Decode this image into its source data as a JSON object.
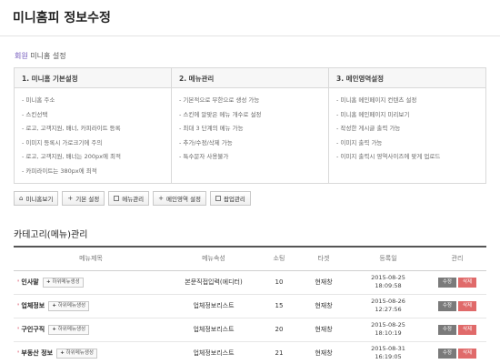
{
  "page": {
    "title": "미니홈피 정보수정"
  },
  "breadcrumb": {
    "highlight": "회원",
    "rest": " 미니홈 설정"
  },
  "info_columns": [
    {
      "title": "1. 미니홈 기본설정",
      "items": [
        "- 미니홈 주소",
        "- 스킨선택",
        "- 로고, 고객지원, 배너, 카피라이트 등록",
        "- 이미지 등록시 가로크기에 주의",
        "- 로고, 고객지원, 배너는 200px에 최적",
        "- 카피라이트는 380px에 최적"
      ]
    },
    {
      "title": "2. 메뉴관리",
      "items": [
        "- 기본적으로 무한으로 생성 가능",
        "- 스킨에 알맞은 메뉴 개수로 설정",
        "- 최대 3 단계의 메뉴 가능",
        "- 추가/수정/삭제 가능",
        "- 특수문자 사용불가"
      ]
    },
    {
      "title": "3. 메인영역설정",
      "items": [
        "- 미니홈 메인페이지 컨텐츠 설정",
        "- 미니홈 메인페이지 미리보기",
        "- 작성한 게시글 출력 가능",
        "- 이미지 출력 가능",
        "- 이미지 출력시 영역사이즈에 맞게 업로드"
      ]
    }
  ],
  "toolbar": {
    "home_preview": "미니홈보기",
    "basic_settings": "기본 설정",
    "menu_manage": "메뉴관리",
    "main_area": "메인영역 설정",
    "popup_manage": "팝업관리"
  },
  "section": {
    "title": "카테고리(메뉴)관리"
  },
  "table": {
    "headers": [
      "메뉴제목",
      "메뉴속성",
      "소팅",
      "타겟",
      "등록일",
      "관리"
    ],
    "sub_menu_label": "하위메뉴생성",
    "edit_label": "수정",
    "delete_label": "삭제",
    "rows": [
      {
        "name": "인사말",
        "attr": "본문직접입력(에디터)",
        "sort": "10",
        "target": "현재창",
        "date": "2015-08-25",
        "time": "18:09:58"
      },
      {
        "name": "업체정보",
        "attr": "업체정보리스트",
        "sort": "15",
        "target": "현재창",
        "date": "2015-08-26",
        "time": "12:27:56"
      },
      {
        "name": "구인구직",
        "attr": "업체정보리스트",
        "sort": "20",
        "target": "현재창",
        "date": "2015-08-25",
        "time": "18:10:19"
      },
      {
        "name": "부동산 정보",
        "attr": "업체정보리스트",
        "sort": "21",
        "target": "현재창",
        "date": "2015-08-31",
        "time": "16:19:05"
      }
    ]
  },
  "colors": {
    "accent": "#6a4fb8",
    "bullet": "#d8425a",
    "edit": "#7a7a7a",
    "delete": "#e06a6a"
  }
}
